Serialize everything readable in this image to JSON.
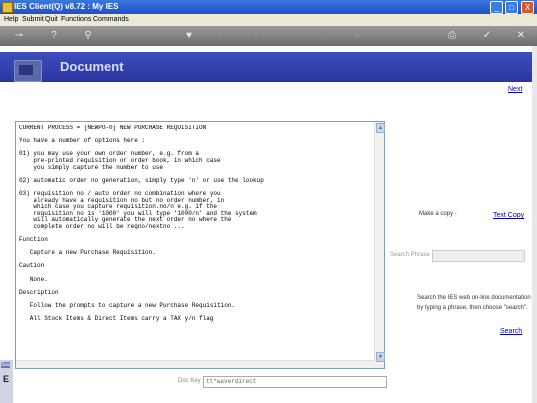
{
  "window": {
    "title": "IES Client(Q) v8.72 : My IES"
  },
  "window_buttons": [
    "_",
    "□",
    "X"
  ],
  "menu": [
    "Help",
    "Submit",
    "Quit",
    "Functions",
    "Commands"
  ],
  "toolbar_icons": [
    "key-icon",
    "help-icon",
    "search-icon",
    "heart-icon",
    "refresh-icon",
    "rewind-icon",
    "fast-forward-icon",
    "forward-icon",
    "stop-icon",
    "print-icon",
    "check-icon",
    "close-icon"
  ],
  "header": {
    "title": "Document"
  },
  "nav": {
    "next_label": "Next"
  },
  "document_text": [
    "CURRENT PROCESS = [NEWPO-0] NEW PURCHASE REQUISITION",
    "",
    "You have a number of options here :",
    "",
    "01) you may use your own order number, e.g. from a",
    "    pre-printed requisition or order book, in which case",
    "    you simply capture the number to use",
    "",
    "02) automatic order no generation, simply type 'n' or use the lookup",
    "",
    "03) requisition no / auto order no combination where you",
    "    already have a requisition no but no order number, in",
    "    which case you capture requisition.no/n e.g. if the",
    "    requisition no is '1000' you will type '1000/n' and the system",
    "    will automatically generate the next order no where the",
    "    complete order no will be reqno/nextno ...",
    "",
    "Function",
    "",
    "   Capture a new Purchase Requisition.",
    "",
    "Caution",
    "",
    "   None.",
    "",
    "Description",
    "",
    "   Follow the prompts to capture a new Purchase Requisition.",
    "",
    "   All Stock Items & Direct Items carry a TAX y/n flag"
  ],
  "copy": {
    "label": "Make a copy -",
    "link": "Text Copy"
  },
  "search": {
    "phrase_label": "Search Phrase",
    "phrase_value": "",
    "help_line1": "Search the IES web on-line documentation",
    "help_line2": "by typing a phrase, then choose \"search\".",
    "button_label": "Search"
  },
  "doc_key": {
    "label": "Doc Key",
    "value": "tt*waverdirect"
  },
  "left_strip": {
    "label1": "Sea",
    "label2": "E"
  }
}
